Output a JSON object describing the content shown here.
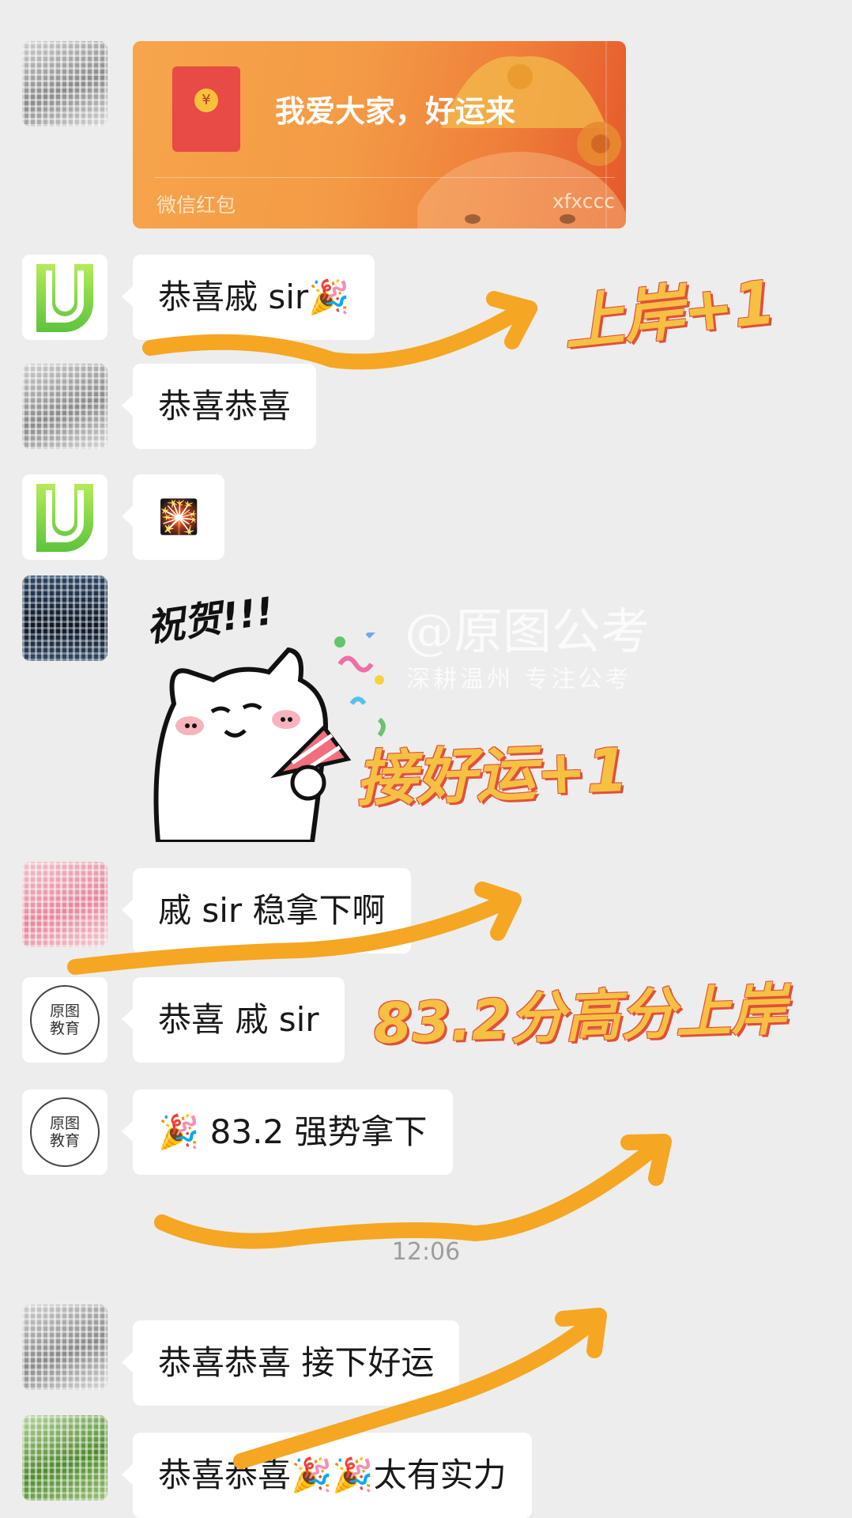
{
  "red_packet": {
    "message": "我爱大家，好运来",
    "label": "微信红包",
    "sender": "xfxccc",
    "coin_symbol": "¥"
  },
  "messages": [
    {
      "text": "恭喜戚 sir🎉"
    },
    {
      "text": "恭喜恭喜"
    },
    {
      "text": "🎇"
    },
    {
      "text": "戚 sir 稳拿下啊"
    },
    {
      "text": "恭喜 戚 sir"
    },
    {
      "text": "🎉 83.2 强势拿下"
    },
    {
      "text": "恭喜恭喜 接下好运"
    },
    {
      "text": "恭喜恭喜🎉🎉太有实力"
    }
  ],
  "timestamp": "12:06",
  "seal_avatar": {
    "line1": "原图",
    "line2": "教育"
  },
  "sticker": {
    "caption": "祝贺!!!"
  },
  "watermark": {
    "title": "@原图公考",
    "subtitle": "深耕温州  专注公考"
  },
  "overlays": {
    "landing": "上岸+1",
    "luck": "接好运+1",
    "score": "83.2分高分上岸"
  },
  "colors": {
    "background": "#ededed",
    "bubble": "#ffffff",
    "red_packet": "#f39a45",
    "arrow": "#f5a623",
    "overlay_text": "#f6c043",
    "overlay_outline": "#e0503a"
  }
}
